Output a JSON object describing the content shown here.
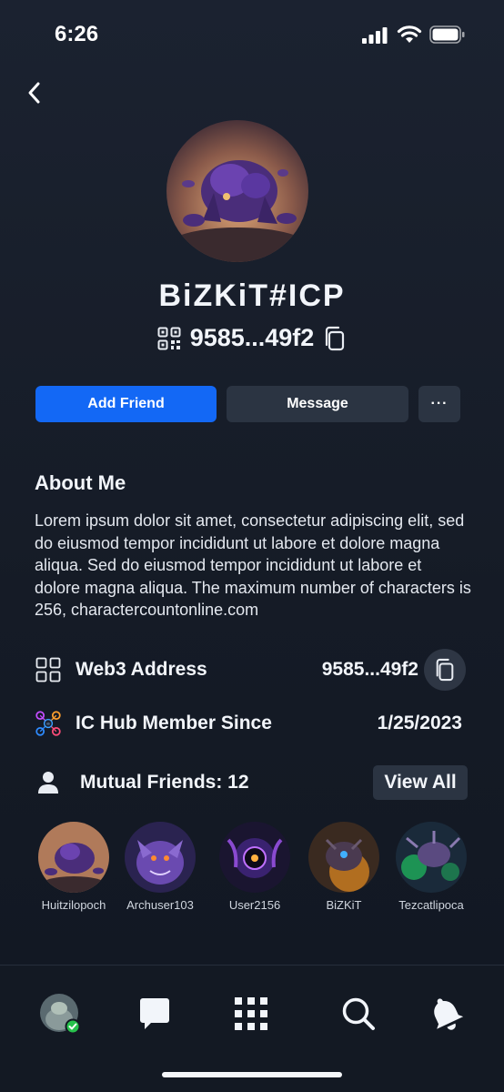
{
  "status": {
    "time": "6:26"
  },
  "profile": {
    "username": "BiZKiT#ICP",
    "address_short": "9585...49f2"
  },
  "actions": {
    "add_friend": "Add Friend",
    "message": "Message",
    "more": "···"
  },
  "about": {
    "title": "About Me",
    "text": "Lorem ipsum dolor sit amet, consectetur adipiscing elit, sed do eiusmod tempor incididunt ut labore et dolore magna aliqua. Sed do eiusmod tempor incididunt ut labore et dolore magna aliqua. The maximum number of characters is 256, charactercountonline.com"
  },
  "info": {
    "web3_label": "Web3 Address",
    "web3_value": "9585...49f2",
    "member_label": "IC Hub Member Since",
    "member_value": "1/25/2023"
  },
  "mutual": {
    "label": "Mutual Friends: 12",
    "view_all": "View All",
    "friends": [
      {
        "name": "Huitzilopoch"
      },
      {
        "name": "Archuser103"
      },
      {
        "name": "User2156"
      },
      {
        "name": "BiZKiT"
      },
      {
        "name": "Tezcatlipoca"
      }
    ]
  },
  "tabs": [
    "profile-avatar",
    "chat-icon",
    "apps-grid-icon",
    "search-icon",
    "bell-icon"
  ],
  "colors": {
    "accent": "#1368f5",
    "background": "#1b2230",
    "button_secondary": "#2b3442",
    "online": "#27c24c"
  }
}
